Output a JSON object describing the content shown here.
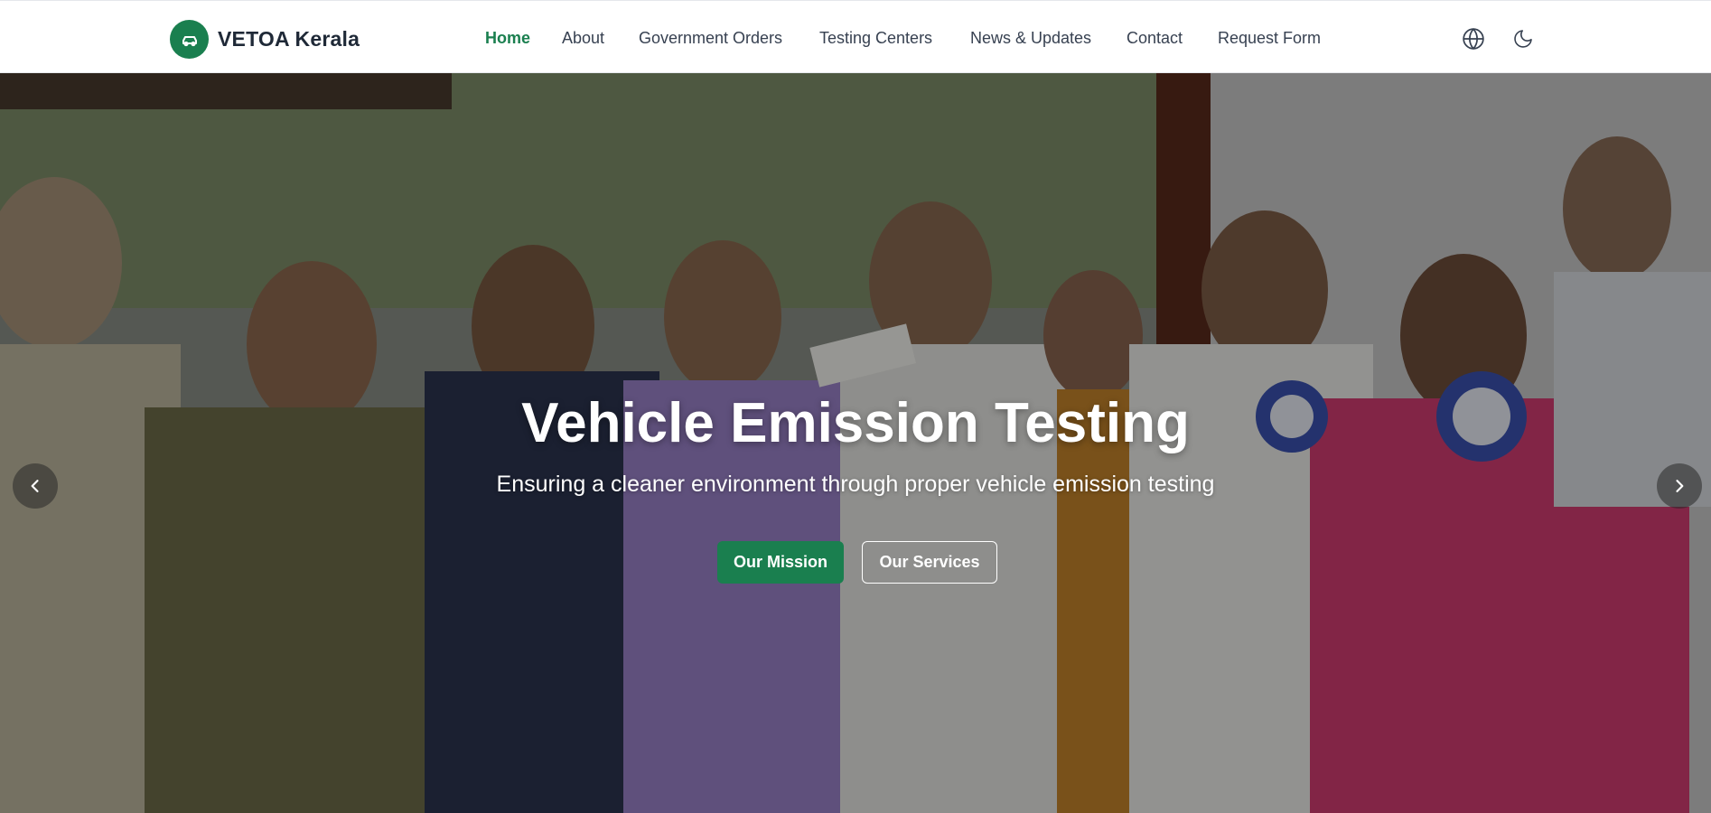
{
  "brand": {
    "name": "VETOA Kerala",
    "logo_icon": "car-icon",
    "accent": "#1a7f4f"
  },
  "nav": {
    "items": [
      {
        "label": "Home",
        "active": true
      },
      {
        "label": "About",
        "active": false
      },
      {
        "label": "Government Orders",
        "active": false
      },
      {
        "label": "Testing Centers",
        "active": false
      },
      {
        "label": "News & Updates",
        "active": false
      },
      {
        "label": "Contact",
        "active": false
      },
      {
        "label": "Request Form",
        "active": false
      }
    ],
    "icons": [
      "globe-icon",
      "moon-icon"
    ]
  },
  "hero": {
    "title": "Vehicle Emission Testing",
    "subtitle": "Ensuring a cleaner environment through proper vehicle emission testing",
    "primary_button": "Our Mission",
    "secondary_button": "Our Services",
    "prev_icon": "chevron-left-icon",
    "next_icon": "chevron-right-icon"
  }
}
